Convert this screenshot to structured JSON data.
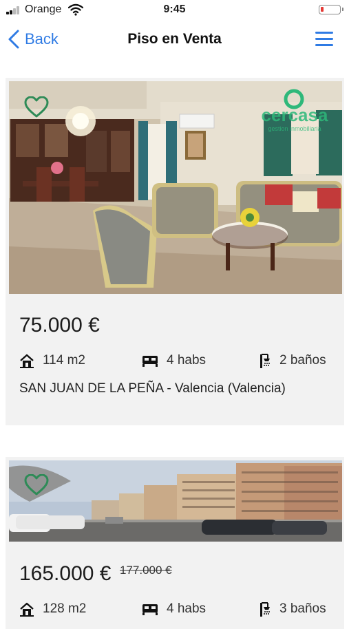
{
  "status_bar": {
    "carrier": "Orange",
    "time": "9:45",
    "battery_level": 0.1,
    "battery_color": "#e53935"
  },
  "nav": {
    "back_label": "Back",
    "title": "Piso en Venta",
    "back_icon": "chevron-left-icon",
    "menu_icon": "hamburger-menu-icon",
    "accent_color": "#2f7be4"
  },
  "listings": [
    {
      "price": "75.000 €",
      "old_price": "",
      "area": "114 m2",
      "rooms": "4 habs",
      "baths": "2 baños",
      "location": "SAN JUAN DE LA PEÑA - Valencia (Valencia)",
      "photo": "living-room-photo",
      "watermark": "cercasa",
      "watermark_tagline": "gestion inmobiliaria",
      "favorite_icon": "heart-outline-icon"
    },
    {
      "price": "165.000 €",
      "old_price": "177.000 €",
      "area": "128 m2",
      "rooms": "4 habs",
      "baths": "3 baños",
      "photo": "street-buildings-photo",
      "favorite_icon": "heart-outline-icon"
    }
  ],
  "colors": {
    "favorite_green": "#2e8b57",
    "card_bg": "#f2f2f2"
  }
}
